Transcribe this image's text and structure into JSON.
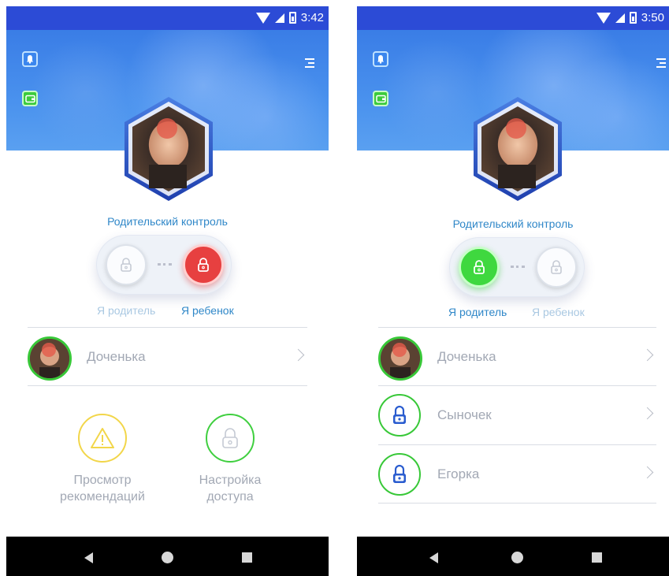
{
  "left": {
    "status": {
      "time": "3:42"
    },
    "header": {
      "bell_icon": "bell-icon",
      "wallet_icon": "wallet-icon",
      "menu_icon": "menu-icon"
    },
    "parental_control": {
      "title": "Родительский контроль",
      "roles": {
        "parent": "Я родитель",
        "child": "Я ребенок"
      },
      "active_role": "child"
    },
    "profiles": [
      {
        "name": "Доченька"
      }
    ],
    "actions": [
      {
        "line1": "Просмотр",
        "line2": "рекомендаций",
        "icon": "warning-icon"
      },
      {
        "line1": "Настройка",
        "line2": "доступа",
        "icon": "lock-icon"
      }
    ]
  },
  "right": {
    "status": {
      "time": "3:50"
    },
    "header": {
      "bell_icon": "bell-icon",
      "wallet_icon": "wallet-icon",
      "menu_icon": "menu-icon"
    },
    "parental_control": {
      "title": "Родительский контроль",
      "roles": {
        "parent": "Я родитель",
        "child": "Я ребенок"
      },
      "active_role": "parent"
    },
    "profiles": [
      {
        "name": "Доченька"
      },
      {
        "name": "Сыночек"
      },
      {
        "name": "Егорка"
      }
    ]
  },
  "colors": {
    "statusbar": "#2c4bd6",
    "accent_blue": "#2f87c8",
    "lock_red": "#e74040",
    "lock_green": "#3fd83f",
    "warning_yellow": "#f2d64a"
  }
}
